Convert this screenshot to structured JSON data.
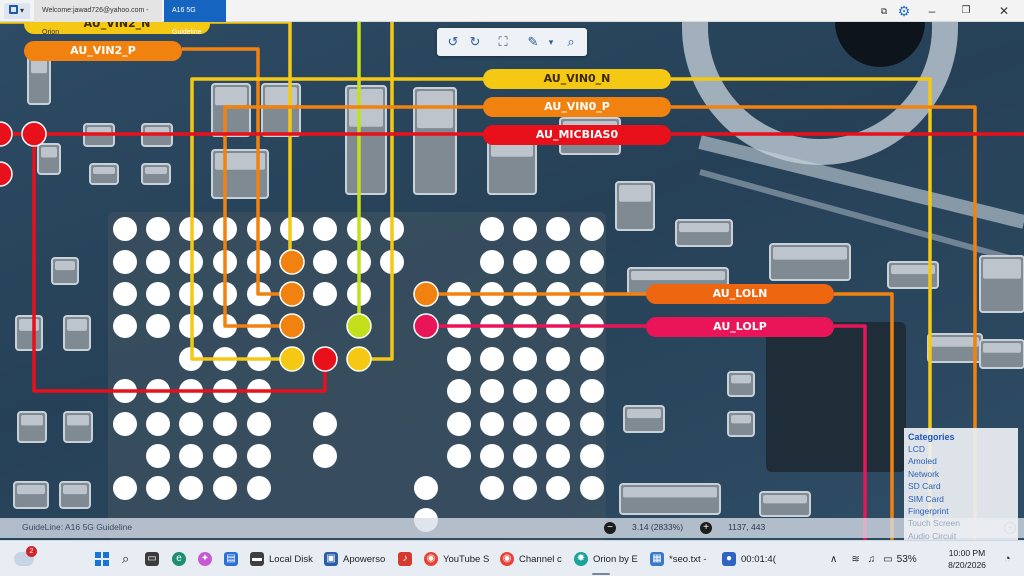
{
  "window": {
    "tabs": [
      {
        "label": "Welcome:jawad726@yahoo.com - Orion"
      },
      {
        "label": "A16 5G Guideline"
      }
    ],
    "icons": [
      "app-icon",
      "share-icon",
      "gear-icon",
      "minimize-icon",
      "maximize-icon",
      "close-icon"
    ]
  },
  "toolbar": {
    "tools": [
      "rotate-left-icon",
      "rotate-right-icon",
      "fit-screen-icon",
      "pen-icon",
      "search-icon"
    ]
  },
  "nets": [
    {
      "label": "AU_VIN2_N",
      "color": "#f4c813"
    },
    {
      "label": "AU_VIN2_P",
      "color": "#f2820f"
    },
    {
      "label": "AU_VIN0_N",
      "color": "#f4c813"
    },
    {
      "label": "AU_VIN0_P",
      "color": "#f2820f"
    },
    {
      "label": "AU_MICBIAS0",
      "color": "#e8101a"
    },
    {
      "label": "AU_LOLN",
      "color": "#ef6611"
    },
    {
      "label": "AU_LOLP",
      "color": "#ea1559"
    }
  ],
  "categories": {
    "title": "Categories",
    "items": [
      "LCD",
      "Amoled",
      "Network",
      "SD Card",
      "SIM Card",
      "Fingerprint",
      "Touch Screen",
      "Audio Circuit"
    ]
  },
  "status": {
    "guideline": "GuideLine: A16 5G Guideline",
    "zoom": "3.14 (2833%)",
    "coords": "1137, 443"
  },
  "taskbar": {
    "weather_badge": "2",
    "apps": [
      {
        "label": "Local Disk"
      },
      {
        "label": "Apowerso"
      },
      {
        "label": "YouTube S"
      },
      {
        "label": "Channel c"
      },
      {
        "label": "Orion by E"
      },
      {
        "label": "*seo.txt -"
      },
      {
        "label": "00:01:4("
      }
    ],
    "battery": "53%",
    "time": "10:00 PM",
    "date": "8/20/2026"
  },
  "colors": {
    "yellow": "#f4c813",
    "orange": "#f2820f",
    "red": "#e8101a",
    "lime": "#c4e01c",
    "pink": "#ea1559",
    "accent": "#1565c0"
  }
}
